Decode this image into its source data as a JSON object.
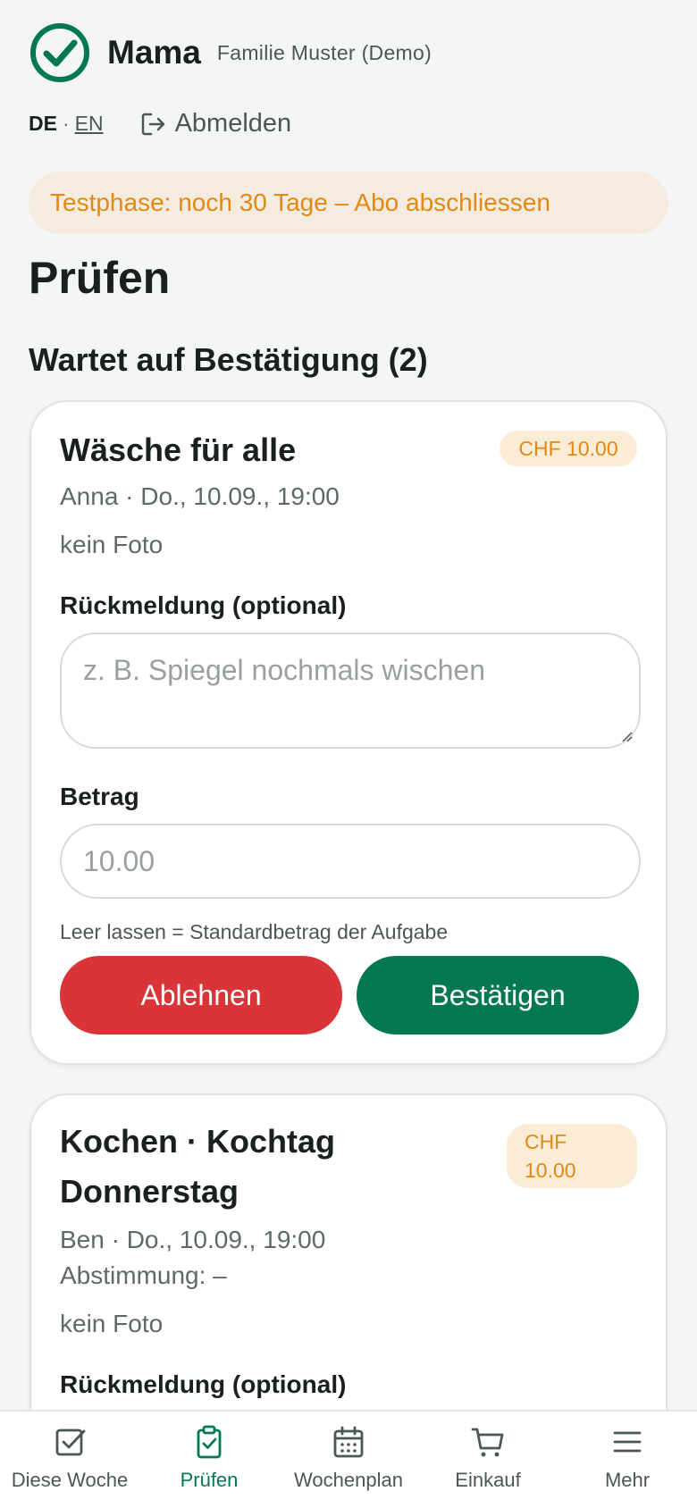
{
  "header": {
    "app_user": "Mama",
    "family": "Familie Muster (Demo)",
    "lang_de": "DE",
    "lang_sep": "·",
    "lang_en": "EN",
    "logout": "Abmelden"
  },
  "banner": {
    "text": "Testphase: noch 30 Tage – Abo abschliessen"
  },
  "page": {
    "title": "Prüfen",
    "section": "Wartet auf Bestätigung (2)"
  },
  "cards": [
    {
      "title": "Wäsche für alle",
      "amount": "CHF 10.00",
      "meta": "Anna · Do., 10.09., 19:00",
      "photo": "kein Foto",
      "feedback_label": "Rückmeldung (optional)",
      "feedback_placeholder": "z. B. Spiegel nochmals wischen",
      "amount_label": "Betrag",
      "amount_placeholder": "10.00",
      "hint": "Leer lassen = Standardbetrag der Aufgabe",
      "reject": "Ablehnen",
      "confirm": "Bestätigen"
    },
    {
      "title_line1": "Kochen · Kochtag",
      "title_line2": "Donnerstag",
      "amount_line1": "CHF",
      "amount_line2": "10.00",
      "meta": "Ben · Do., 10.09., 19:00",
      "vote": "Abstimmung: –",
      "photo": "kein Foto",
      "feedback_label": "Rückmeldung (optional)"
    }
  ],
  "nav": [
    {
      "label": "Diese Woche",
      "icon": "checkbox-icon"
    },
    {
      "label": "Prüfen",
      "icon": "clipboard-check-icon"
    },
    {
      "label": "Wochenplan",
      "icon": "calendar-icon"
    },
    {
      "label": "Einkauf",
      "icon": "cart-icon"
    },
    {
      "label": "Mehr",
      "icon": "menu-icon"
    }
  ],
  "colors": {
    "brand_green": "#047851",
    "reject_red": "#d93438",
    "banner_bg": "#f5ecdf",
    "banner_text": "#e08a14"
  }
}
